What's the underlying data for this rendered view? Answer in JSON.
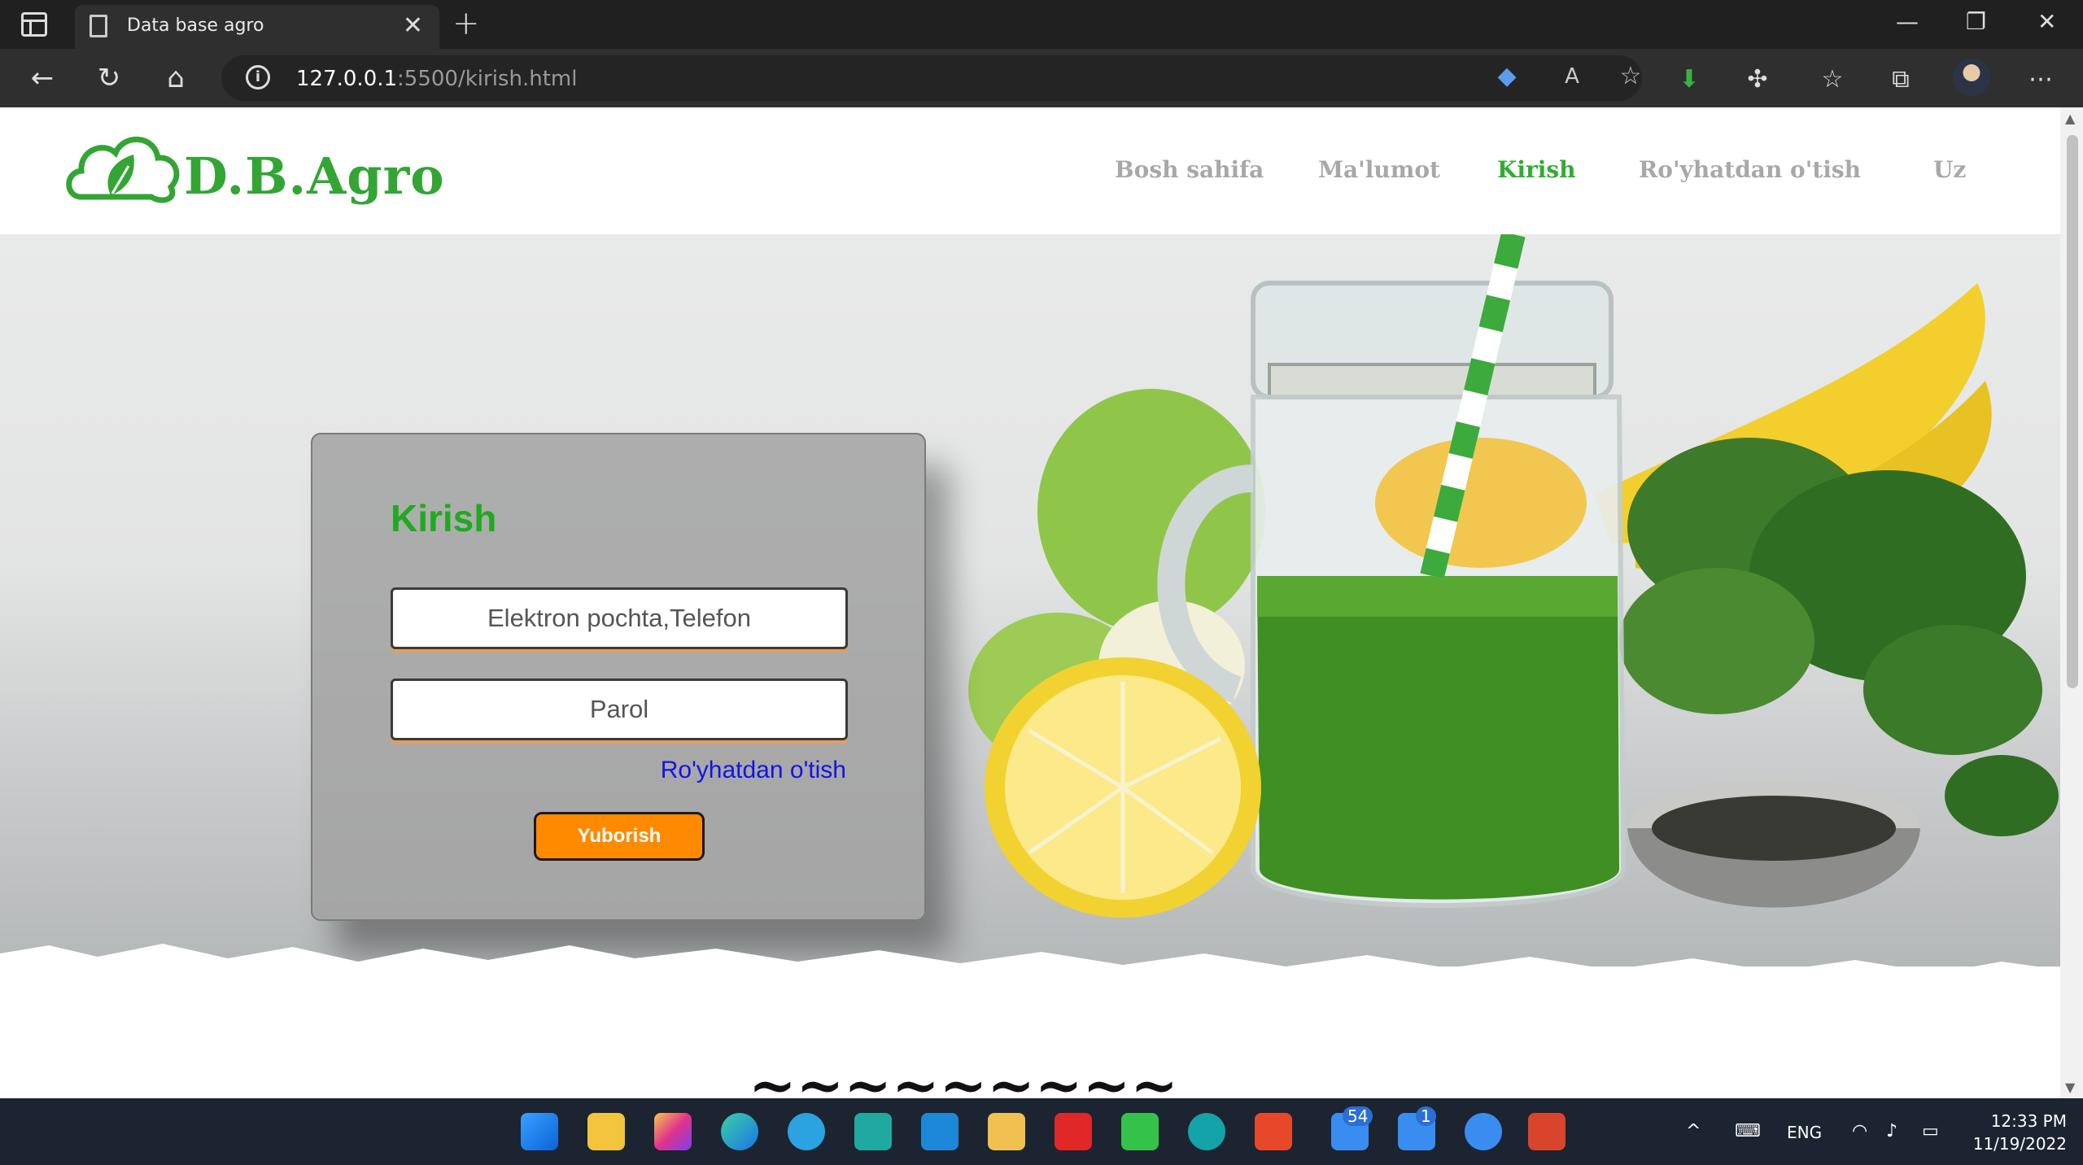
{
  "browser": {
    "tab_title": "Data base agro",
    "url_host": "127.0.0.1",
    "url_path": ":5500/kirish.html"
  },
  "site": {
    "logo_text": "D.B.Agro",
    "nav": [
      {
        "label": "Bosh sahifa",
        "active": false
      },
      {
        "label": "Ma'lumot",
        "active": false
      },
      {
        "label": "Kirish",
        "active": true
      },
      {
        "label": "Ro'yhatdan o'tish",
        "active": false
      },
      {
        "label": "Uz",
        "active": false
      }
    ]
  },
  "login": {
    "title": "Kirish",
    "login_placeholder": "Elektron pochta,Telefon",
    "password_placeholder": "Parol",
    "register_link": "Ro'yhatdan o'tish",
    "submit_label": "Yuborish"
  },
  "colors": {
    "brand_green": "#33a535",
    "submit_orange": "#ff8a00",
    "link_blue": "#1414e6"
  },
  "taskbar": {
    "store_badge": "54",
    "mail_badge": "1",
    "language": "ENG",
    "time": "12:33 PM",
    "date": "11/19/2022"
  }
}
